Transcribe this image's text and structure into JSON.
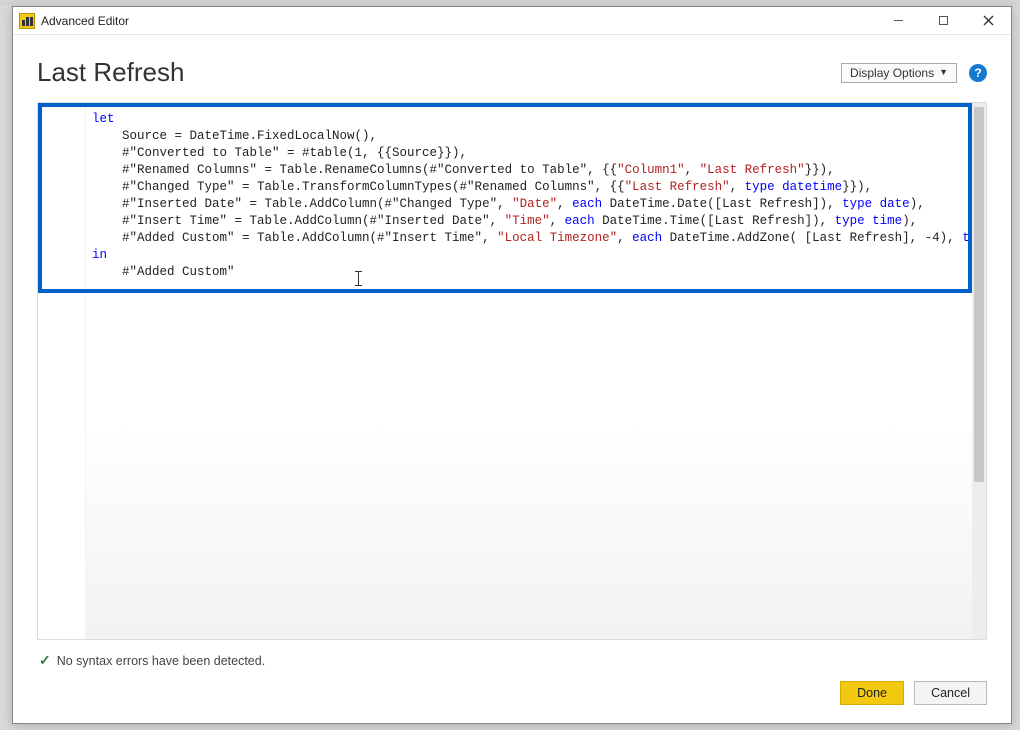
{
  "window": {
    "title": "Advanced Editor"
  },
  "header": {
    "page_title": "Last Refresh",
    "display_options_label": "Display Options"
  },
  "code": {
    "line1_kw": "let",
    "line2": "    Source = DateTime.FixedLocalNow(),",
    "line3_a": "    #\"Converted to Table\" = #table(1, {{Source}}),",
    "line4_a": "    #\"Renamed Columns\" = Table.RenameColumns(#\"Converted to Table\", {{",
    "line4_s1": "\"Column1\"",
    "line4_m": ", ",
    "line4_s2": "\"Last Refresh\"",
    "line4_b": "}}),",
    "line5_a": "    #\"Changed Type\" = Table.TransformColumnTypes(#\"Renamed Columns\", {{",
    "line5_s1": "\"Last Refresh\"",
    "line5_m": ", ",
    "line5_t": "type datetime",
    "line5_b": "}}),",
    "line6_a": "    #\"Inserted Date\" = Table.AddColumn(#\"Changed Type\", ",
    "line6_s1": "\"Date\"",
    "line6_m": ", ",
    "line6_kw": "each",
    "line6_c": " DateTime.Date([Last Refresh]), ",
    "line6_t": "type date",
    "line6_b": "),",
    "line7_a": "    #\"Insert Time\" = Table.AddColumn(#\"Inserted Date\", ",
    "line7_s1": "\"Time\"",
    "line7_m": ", ",
    "line7_kw": "each",
    "line7_c": " DateTime.Time([Last Refresh]), ",
    "line7_t": "type time",
    "line7_b": "),",
    "line8_a": "    #\"Added Custom\" = Table.AddColumn(#\"Insert Time\", ",
    "line8_s1": "\"Local Timezone\"",
    "line8_m": ", ",
    "line8_kw": "each",
    "line8_c": " DateTime.AddZone( [Last Refresh], -4), ",
    "line8_t": "type datetimezone",
    "line8_b": " )",
    "line9_kw": "in",
    "line10": "    #\"Added Custom\""
  },
  "status": {
    "message": "No syntax errors have been detected."
  },
  "footer": {
    "done_label": "Done",
    "cancel_label": "Cancel"
  }
}
